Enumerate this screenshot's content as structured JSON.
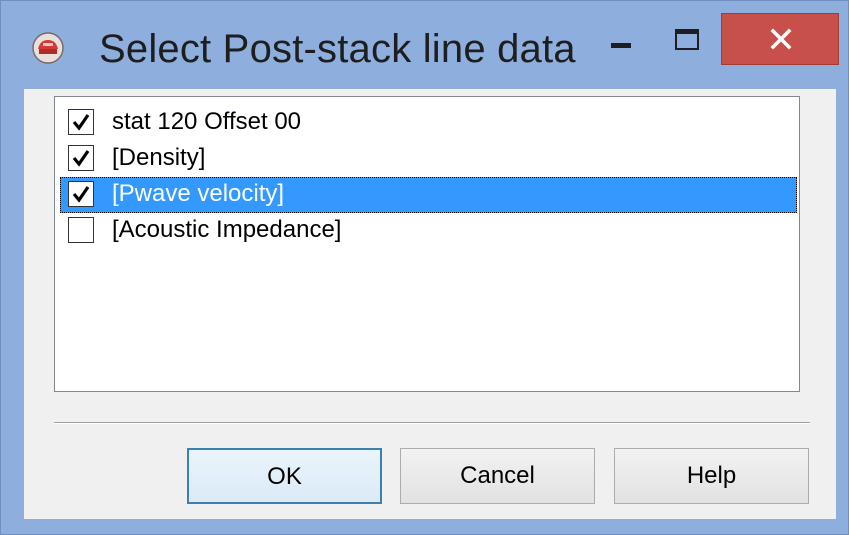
{
  "window": {
    "title": "Select Post-stack line data",
    "close_label": "×"
  },
  "list": {
    "items": [
      {
        "label": "stat 120 Offset 00",
        "checked": true,
        "selected": false
      },
      {
        "label": "[Density]",
        "checked": true,
        "selected": false
      },
      {
        "label": "[Pwave velocity]",
        "checked": true,
        "selected": true
      },
      {
        "label": "[Acoustic Impedance]",
        "checked": false,
        "selected": false
      }
    ]
  },
  "buttons": {
    "ok": "OK",
    "cancel": "Cancel",
    "help": "Help"
  },
  "colors": {
    "frame": "#8eaede",
    "close": "#c7504a",
    "selection": "#3399ff",
    "default_button_border": "#3c7fb1"
  }
}
